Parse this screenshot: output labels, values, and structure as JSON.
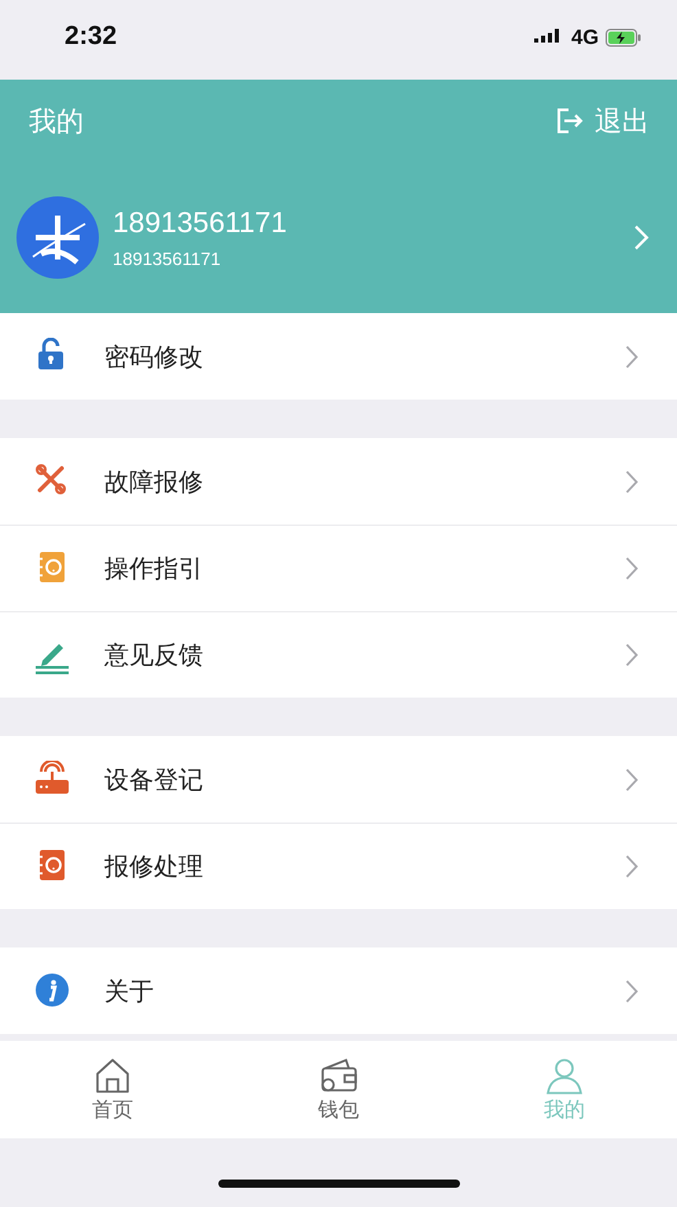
{
  "status_bar": {
    "time": "2:32",
    "network": "4G"
  },
  "header": {
    "title": "我的",
    "logout": "退出"
  },
  "profile": {
    "name": "18913561171",
    "account": "18913561171"
  },
  "groups": [
    {
      "items": [
        {
          "label": "密码修改"
        }
      ]
    },
    {
      "items": [
        {
          "label": "故障报修"
        },
        {
          "label": "操作指引"
        },
        {
          "label": "意见反馈"
        }
      ]
    },
    {
      "items": [
        {
          "label": "设备登记"
        },
        {
          "label": "报修处理"
        }
      ]
    },
    {
      "items": [
        {
          "label": "关于"
        }
      ]
    }
  ],
  "tabs": [
    {
      "label": "首页",
      "selected": false
    },
    {
      "label": "钱包",
      "selected": false
    },
    {
      "label": "我的",
      "selected": true
    }
  ]
}
